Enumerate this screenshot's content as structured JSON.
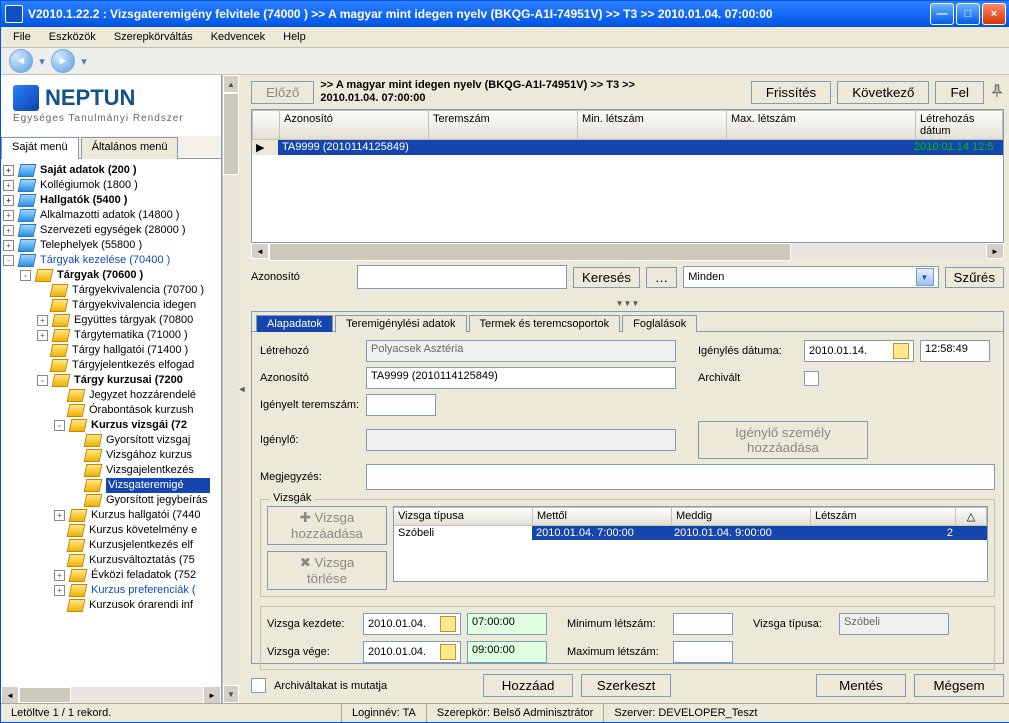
{
  "title": "V2010.1.22.2 : Vizsgateremigény felvitele (74000  )  >> A magyar mint idegen nyelv (BKQG-A1I-74951V) >> T3 >> 2010.01.04. 07:00:00",
  "menubar": [
    "File",
    "Eszközök",
    "Szerepkörváltás",
    "Kedvencek",
    "Help"
  ],
  "logo": {
    "name": "NEPTUN",
    "sub": "Egységes Tanulmányi Rendszer"
  },
  "tree_tabs": {
    "own": "Saját menü",
    "general": "Általános menü"
  },
  "tree": [
    {
      "d": 0,
      "pm": "+",
      "bold": true,
      "txt": "Saját adatok (200  )"
    },
    {
      "d": 0,
      "pm": "+",
      "txt": "Kollégiumok (1800  )"
    },
    {
      "d": 0,
      "pm": "+",
      "bold": true,
      "txt": "Hallgatók (5400  )"
    },
    {
      "d": 0,
      "pm": "+",
      "txt": "Alkalmazotti adatok (14800  )"
    },
    {
      "d": 0,
      "pm": "+",
      "txt": "Szervezeti egységek (28000  )"
    },
    {
      "d": 0,
      "pm": "+",
      "txt": "Telephelyek (55800  )"
    },
    {
      "d": 0,
      "pm": "-",
      "link": true,
      "txt": "Tárgyak kezelése (70400  )"
    },
    {
      "d": 1,
      "pm": "-",
      "bold": true,
      "y": true,
      "txt": "Tárgyak (70600  )"
    },
    {
      "d": 2,
      "pm": " ",
      "y": true,
      "txt": "Tárgyekvivalencia (70700  )"
    },
    {
      "d": 2,
      "pm": " ",
      "y": true,
      "txt": "Tárgyekvivalencia idegen"
    },
    {
      "d": 2,
      "pm": "+",
      "y": true,
      "txt": "Együttes tárgyak (70800"
    },
    {
      "d": 2,
      "pm": "+",
      "y": true,
      "txt": "Tárgytematika (71000  )"
    },
    {
      "d": 2,
      "pm": " ",
      "y": true,
      "txt": "Tárgy hallgatói (71400  )"
    },
    {
      "d": 2,
      "pm": " ",
      "y": true,
      "txt": "Tárgyjelentkezés elfogad"
    },
    {
      "d": 2,
      "pm": "-",
      "bold": true,
      "y": true,
      "txt": "Tárgy kurzusai (7200"
    },
    {
      "d": 3,
      "pm": " ",
      "y": true,
      "txt": "Jegyzet hozzárendelé"
    },
    {
      "d": 3,
      "pm": " ",
      "y": true,
      "txt": "Órabontások kurzush"
    },
    {
      "d": 3,
      "pm": "-",
      "bold": true,
      "y": true,
      "txt": "Kurzus vizsgái (72"
    },
    {
      "d": 4,
      "pm": " ",
      "y": true,
      "txt": "Gyorsított vizsgaj"
    },
    {
      "d": 4,
      "pm": " ",
      "y": true,
      "txt": "Vizsgához kurzus"
    },
    {
      "d": 4,
      "pm": " ",
      "y": true,
      "txt": "Vizsgajelentkezés"
    },
    {
      "d": 4,
      "pm": " ",
      "y": true,
      "sel": true,
      "txt": "Vizsgateremigé"
    },
    {
      "d": 4,
      "pm": " ",
      "y": true,
      "txt": "Gyorsított jegybeírás"
    },
    {
      "d": 3,
      "pm": "+",
      "y": true,
      "txt": "Kurzus hallgatói (7440"
    },
    {
      "d": 3,
      "pm": " ",
      "y": true,
      "txt": "Kurzus követelmény e"
    },
    {
      "d": 3,
      "pm": " ",
      "y": true,
      "txt": "Kurzusjelentkezés elf"
    },
    {
      "d": 3,
      "pm": " ",
      "y": true,
      "txt": "Kurzusváltoztatás (75"
    },
    {
      "d": 3,
      "pm": "+",
      "y": true,
      "txt": "Évközi feladatok (752"
    },
    {
      "d": 3,
      "pm": "+",
      "y": true,
      "link": true,
      "txt": "Kurzus preferenciák ("
    },
    {
      "d": 3,
      "pm": " ",
      "y": true,
      "txt": "Kurzusok órarendi inf"
    }
  ],
  "toolbar": {
    "prev": "Előző",
    "refresh": "Frissítés",
    "next": "Következő",
    "up": "Fel"
  },
  "breadcrumb_top": ">> A magyar mint idegen nyelv (BKQG-A1I-74951V) >> T3 >>",
  "breadcrumb_sub": "2010.01.04. 07:00:00",
  "grid_cols": [
    "",
    "Azonosító",
    "Teremszám",
    "Min. létszám",
    "Max. létszám",
    "Létrehozás dátum"
  ],
  "grid_row": {
    "azon": "TA9999 (2010114125849)",
    "letre": "2010:01.14 12:5"
  },
  "search": {
    "lbl": "Azonosító",
    "btn": "Keresés",
    "all": "Minden",
    "filter": "Szűrés"
  },
  "card_tabs": [
    "Alapadatok",
    "Teremigénylési adatok",
    "Termek és teremcsoportok",
    "Foglalások"
  ],
  "form": {
    "letrehozo_lbl": "Létrehozó",
    "letrehozo_val": "Polyacsek Asztéria",
    "igeny_datum_lbl": "Igénylés dátuma:",
    "igeny_datum_val": "2010.01.14.",
    "igeny_time": "12:58:49",
    "azon_lbl": "Azonosító",
    "azon_val": "TA9999 (2010114125849)",
    "archivalt_lbl": "Archivált",
    "igenyteremszam_lbl": "Igényelt teremszám:",
    "igenylo_lbl": "Igénylő:",
    "igenylo_btn": "Igénylő személy hozzáadása",
    "megj_lbl": "Megjegyzés:"
  },
  "vizsgak": {
    "legend": "Vizsgák",
    "add": "Vizsga hozzáadása",
    "del": "Vizsga törlése",
    "cols": [
      "Vizsga típusa",
      "Mettől",
      "Meddig",
      "Létszám",
      "△"
    ],
    "row": {
      "typ": "Szóbeli",
      "from": "2010.01.04. 7:00:00",
      "to": "2010.01.04. 9:00:00",
      "cnt": "2"
    }
  },
  "bottom": {
    "kezd_lbl": "Vizsga kezdete:",
    "kezd_d": "2010.01.04.",
    "kezd_t": "07:00:00",
    "vege_lbl": "Vizsga vége:",
    "vege_d": "2010.01.04.",
    "vege_t": "09:00:00",
    "min_lbl": "Minimum létszám:",
    "max_lbl": "Maximum létszám:",
    "typ_lbl": "Vizsga típusa:",
    "typ_val": "Szóbeli"
  },
  "actions": {
    "arch_chk": "Archiváltakat is mutatja",
    "add": "Hozzáad",
    "edit": "Szerkeszt",
    "save": "Mentés",
    "cancel": "Mégsem"
  },
  "status": {
    "records": "Letöltve 1 / 1 rekord.",
    "login": "Loginnév: TA",
    "role": "Szerepkör: Belső Adminisztrátor",
    "server": "Szerver: DEVELOPER_Teszt"
  }
}
